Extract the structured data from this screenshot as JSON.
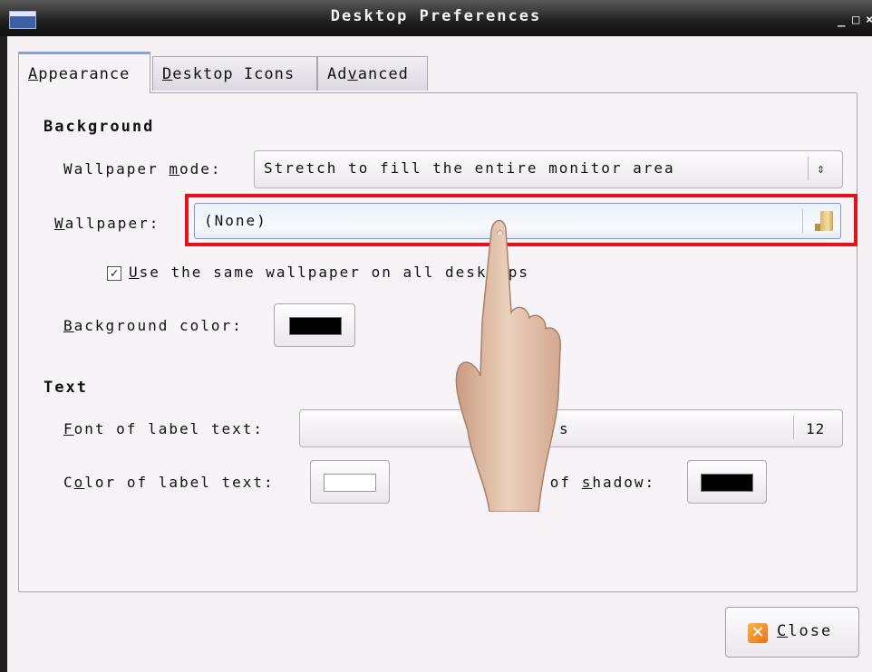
{
  "window": {
    "title": "Desktop Preferences",
    "controls": [
      "_",
      "□",
      "×"
    ]
  },
  "tabs": [
    {
      "pre": "",
      "u": "A",
      "post": "ppearance",
      "active": true
    },
    {
      "pre": "",
      "u": "D",
      "post": "esktop Icons",
      "active": false
    },
    {
      "pre": "Ad",
      "u": "v",
      "post": "anced",
      "active": false
    }
  ],
  "background": {
    "heading": "Background",
    "wallpaper_mode": {
      "pre": "Wallpaper ",
      "u": "m",
      "post": "ode:",
      "value": "Stretch to fill the entire monitor area"
    },
    "wallpaper": {
      "pre": "",
      "u": "W",
      "post": "allpaper:",
      "value": "(None)"
    },
    "same_wallpaper": {
      "pre": "",
      "u": "U",
      "post": "se the same wallpaper on all desktops",
      "checked": true
    },
    "bg_color": {
      "pre": "",
      "u": "B",
      "post": "ackground color:",
      "color": "#000000"
    }
  },
  "text": {
    "heading": "Text",
    "font": {
      "pre": "",
      "u": "F",
      "post": "ont of label text:",
      "font_name": "s",
      "size": "12"
    },
    "label_color": {
      "pre": "C",
      "u": "o",
      "post": "lor of label text:",
      "color": "#ffffff"
    },
    "shadow_color": {
      "pre": "Color of ",
      "u": "s",
      "post": "hadow:",
      "color": "#000000"
    }
  },
  "footer": {
    "close": {
      "pre": "",
      "u": "C",
      "post": "lose"
    }
  },
  "colors": {
    "highlight": "#e8101a",
    "accent": "#8aa3cf"
  }
}
